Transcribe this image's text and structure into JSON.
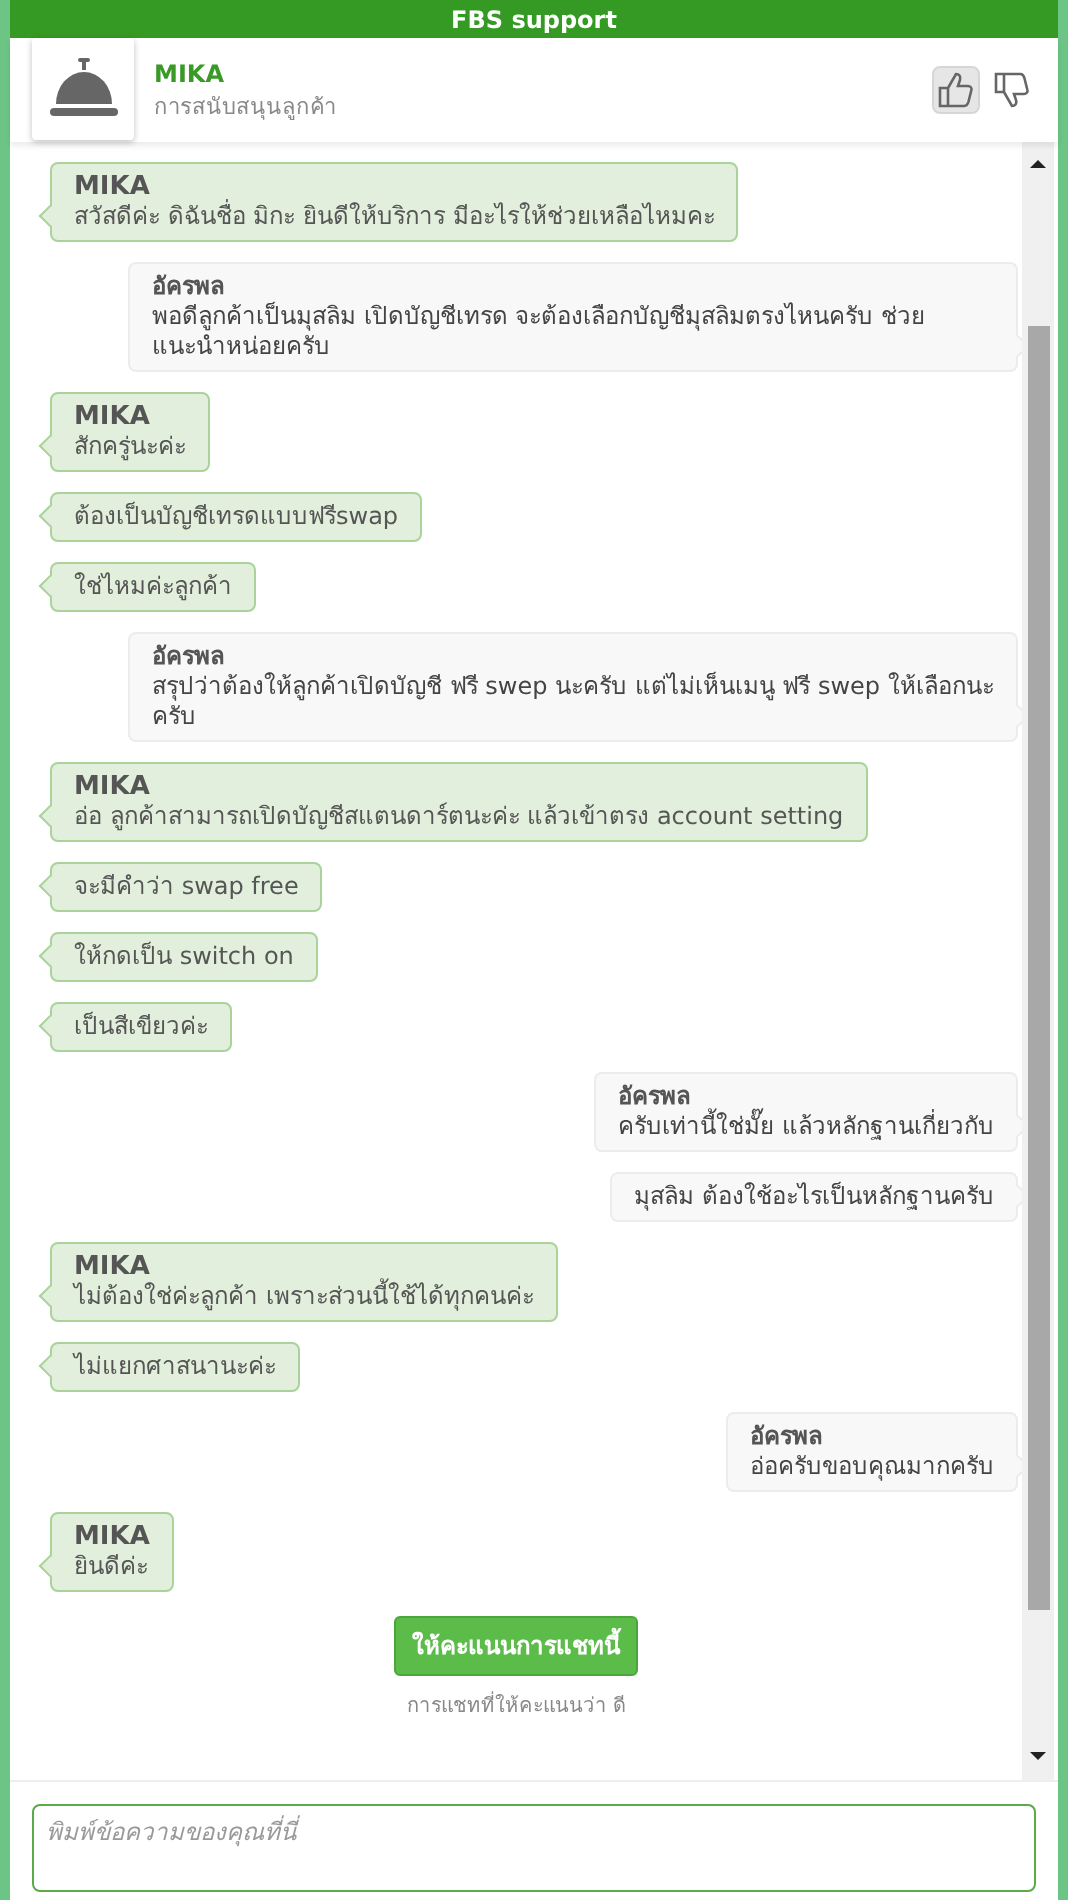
{
  "window": {
    "title": "FBS support"
  },
  "agent": {
    "name": "MIKA",
    "role": "การสนับสนุนลูกค้า"
  },
  "rating": [
    {
      "kind": "up",
      "selected": true
    },
    {
      "kind": "down",
      "selected": false
    }
  ],
  "messages": [
    {
      "kind": "agent",
      "name": "MIKA",
      "text": "สวัสดีค่ะ ดิฉันชื่อ มิกะ ยินดีให้บริการ มีอะไรให้ช่วยเหลือไหมคะ"
    },
    {
      "kind": "visitor",
      "name": "อัครพล",
      "text": "พอดีลูกค้าเป็นมุสลิม  เปิดบัญชีเทรด จะต้องเลือกบัญชีมุสลิมตรงไหนครับ  ช่วยแนะนำหน่อยครับ"
    },
    {
      "kind": "agent",
      "name": "MIKA",
      "text": "สักครู่นะค่ะ"
    },
    {
      "kind": "agent",
      "text": "ต้องเป็นบัญชีเทรดแบบฟรีswap"
    },
    {
      "kind": "agent",
      "text": "ใช่ไหมค่ะลูกค้า"
    },
    {
      "kind": "visitor",
      "name": "อัครพล",
      "text": "สรุปว่าต้องให้ลูกค้าเปิดบัญชี ฟรี swep นะครับ  แต่ไม่เห็นเมนู ฟรี swep ให้เลือกนะครับ"
    },
    {
      "kind": "agent",
      "name": "MIKA",
      "text": "อ่อ ลูกค้าสามารถเปิดบัญชีสแตนดาร์ตนะค่ะ แล้วเข้าตรง account setting"
    },
    {
      "kind": "agent",
      "text": "จะมีคำว่า swap free"
    },
    {
      "kind": "agent",
      "text": "ให้กดเป็น switch on"
    },
    {
      "kind": "agent",
      "text": "เป็นสีเขียวค่ะ"
    },
    {
      "kind": "visitor",
      "name": "อัครพล",
      "text": "ครับเท่านี้ใช่มั๊ย  แล้วหลักฐานเกี่ยวกับ"
    },
    {
      "kind": "visitor",
      "text": "มุสลิม  ต้องใช้อะไรเป็นหลักฐานครับ"
    },
    {
      "kind": "agent",
      "name": "MIKA",
      "text": "ไม่ต้องใช่ค่ะลูกค้า เพราะส่วนนี้ใช้ได้ทุกคนค่ะ"
    },
    {
      "kind": "agent",
      "text": "ไม่แยกศาสนานะค่ะ"
    },
    {
      "kind": "visitor",
      "name": "อัครพล",
      "text": "อ่อครับขอบคุณมากครับ"
    },
    {
      "kind": "agent",
      "name": "MIKA",
      "text": "ยินดีค่ะ"
    }
  ],
  "rate_button": "ให้คะแนนการแชทนี้",
  "rated_note": "การแชทที่ให้คะแนนว่า ดี",
  "composer": {
    "placeholder": "พิมพ์ข้อความของคุณที่นี่"
  }
}
